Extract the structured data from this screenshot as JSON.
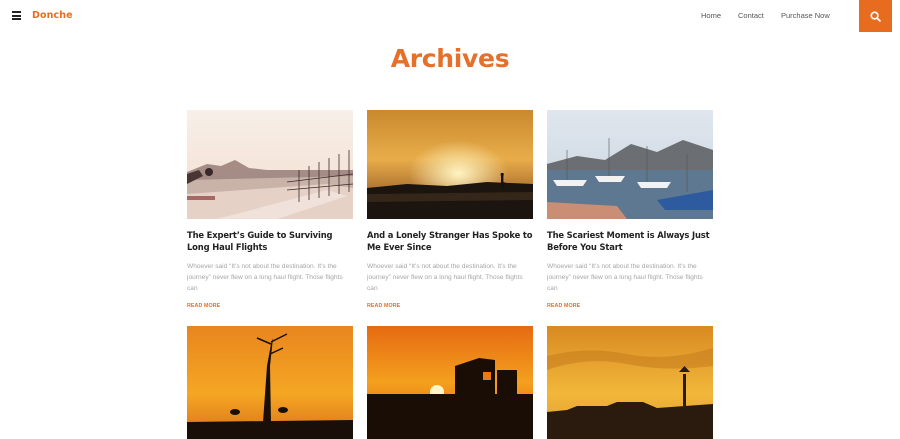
{
  "site": {
    "logo": "Donche"
  },
  "nav": {
    "items": [
      "Home",
      "Contact",
      "Purchase Now"
    ]
  },
  "page_title": "Archives",
  "posts": [
    {
      "title": "The Expert’s Guide to Surviving Long Haul Flights",
      "excerpt": "Whoever said “It’s not about the destination. It’s the journey” never flew on a long haul flight. Those flights can",
      "read_more": "READ MORE"
    },
    {
      "title": "And a Lonely Stranger Has Spoke to Me Ever Since",
      "excerpt": "Whoever said “It’s not about the destination. It’s the journey” never flew on a long haul flight. Those flights can",
      "read_more": "READ MORE"
    },
    {
      "title": "The Scariest Moment is Always Just Before You Start",
      "excerpt": "Whoever said “It’s not about the destination. It’s the journey” never flew on a long haul flight. Those flights can",
      "read_more": "READ MORE"
    }
  ],
  "icons": {
    "menu": "hamburger-icon",
    "search": "search-icon"
  },
  "colors": {
    "accent": "#e86c1f",
    "title": "#e6702a",
    "excerpt": "#a6a6a6"
  }
}
